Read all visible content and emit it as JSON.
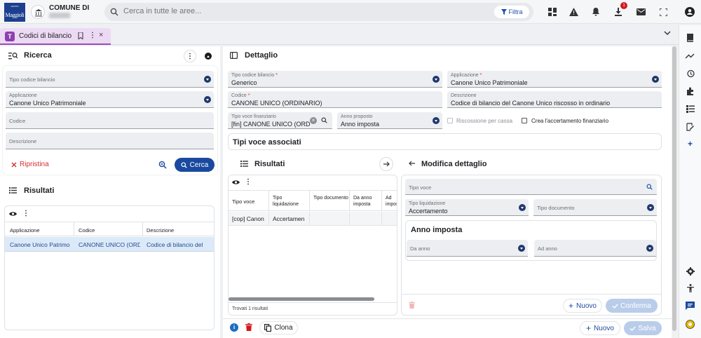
{
  "header": {
    "comune_label": "COMUNE DI",
    "logo_text": "Maggioli",
    "search_placeholder": "Cerca in tutte le aree...",
    "filter_label": "Filtra",
    "download_badge": "1"
  },
  "tab": {
    "label": "Codici di bilancio",
    "icon_letter": "T"
  },
  "ricerca": {
    "title": "Ricerca",
    "fields": [
      {
        "label": "Tipo codice bilancio",
        "value": ""
      },
      {
        "label": "Applicazione",
        "value": "Canone Unico Patrimoniale"
      },
      {
        "label": "Codice",
        "value": ""
      },
      {
        "label": "Descrizione",
        "value": ""
      }
    ],
    "reset_label": "Ripristina",
    "search_label": "Cerca"
  },
  "risultati_left": {
    "title": "Risultati",
    "columns": [
      "Applicazione",
      "Codice",
      "Descrizione"
    ],
    "rows": [
      [
        "Canone Unico Patrimo",
        "CANONE UNICO (ORDI",
        "Codice di bilancio del"
      ]
    ]
  },
  "dettaglio": {
    "title": "Dettaglio",
    "tipo_codice": {
      "label": "Tipo codice bilancio",
      "value": "Generico"
    },
    "applicazione": {
      "label": "Applicazione",
      "value": "Canone Unico Patrimoniale"
    },
    "codice": {
      "label": "Codice",
      "value": "CANONE UNICO (ORDINARIO)"
    },
    "descrizione": {
      "label": "Descrizione",
      "value": "Codice di bilancio del Canone Unico riscosso in ordinario"
    },
    "tipo_voce_fin": {
      "label": "Tipo voce finanziario",
      "value": "[fin] CANONE UNICO (ORD..."
    },
    "anno_proposto": {
      "label": "Anno proposto",
      "value": "Anno imposta"
    },
    "riscossione_label": "Riscossione per cassa",
    "accertamento_label": "Crea l'accertamento finanziario",
    "tipi_voce_title": "Tipi voce associati",
    "clona_label": "Clona",
    "nuovo_label": "Nuovo",
    "salva_label": "Salva"
  },
  "risultati_inner": {
    "title": "Risultati",
    "columns": [
      "Tipo voce",
      "Tipo liquidazione",
      "Tipo documento",
      "Da anno imposta",
      "Ad imposta"
    ],
    "rows": [
      [
        "[cop] Canon",
        "Accertamen",
        "",
        "",
        ""
      ]
    ],
    "footer": "Trovati 1 risultati"
  },
  "modifica": {
    "title": "Modifica dettaglio",
    "tipo_voce_label": "Tipo voce",
    "tipo_liq_label": "Tipo liquidazione",
    "tipo_liq_value": "Accertamento",
    "tipo_doc_label": "Tipo documento",
    "anno_title": "Anno imposta",
    "da_anno_label": "Da anno",
    "ad_anno_label": "Ad anno",
    "nuovo_label": "Nuovo",
    "conferma_label": "Conferma"
  },
  "colors": {
    "primary": "#1a4a9f",
    "tab_bg": "#ecdaf4",
    "tab_accent": "#9a4cb5",
    "danger": "#d3191e",
    "selected_row": "#dce9f9"
  }
}
